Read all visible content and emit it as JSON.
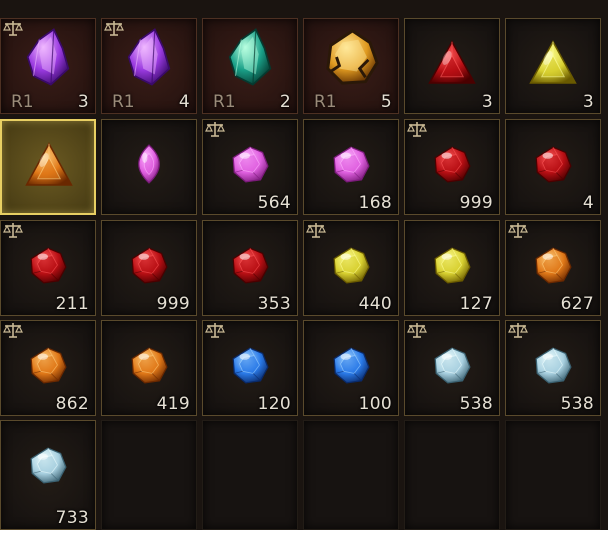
{
  "inventory": {
    "rows": [
      [
        {
          "kind": "rune",
          "icon": "purple-crystal-icon",
          "rank": "R1",
          "count": "3",
          "scale": true
        },
        {
          "kind": "rune",
          "icon": "purple-crystal-icon",
          "rank": "R1",
          "count": "4",
          "scale": true
        },
        {
          "kind": "rune",
          "icon": "green-crystal-icon",
          "rank": "R1",
          "count": "2",
          "scale": false
        },
        {
          "kind": "rune",
          "icon": "amber-crystal-icon",
          "rank": "R1",
          "count": "5",
          "scale": false
        },
        {
          "kind": "item",
          "icon": "red-triangle-gem-icon",
          "count": "3",
          "scale": false
        },
        {
          "kind": "item",
          "icon": "yellow-triangle-gem-icon",
          "count": "3",
          "scale": false
        }
      ],
      [
        {
          "kind": "selected",
          "icon": "orange-triangle-gem-icon",
          "count": "",
          "scale": false
        },
        {
          "kind": "item",
          "icon": "pink-marquise-gem-icon",
          "count": "",
          "scale": false
        },
        {
          "kind": "item",
          "icon": "pink-gem-icon",
          "count": "564",
          "scale": true
        },
        {
          "kind": "item",
          "icon": "pink-gem-icon",
          "count": "168",
          "scale": false
        },
        {
          "kind": "item",
          "icon": "red-gem-icon",
          "count": "999",
          "scale": true
        },
        {
          "kind": "item",
          "icon": "red-gem-icon",
          "count": "4",
          "scale": false
        }
      ],
      [
        {
          "kind": "item",
          "icon": "red-gem-icon",
          "count": "211",
          "scale": true
        },
        {
          "kind": "item",
          "icon": "red-gem-icon",
          "count": "999",
          "scale": false
        },
        {
          "kind": "item",
          "icon": "red-gem-icon",
          "count": "353",
          "scale": false
        },
        {
          "kind": "item",
          "icon": "yellow-gem-icon",
          "count": "440",
          "scale": true
        },
        {
          "kind": "item",
          "icon": "yellow-gem-icon",
          "count": "127",
          "scale": false
        },
        {
          "kind": "item",
          "icon": "orange-gem-icon",
          "count": "627",
          "scale": true
        }
      ],
      [
        {
          "kind": "item",
          "icon": "orange-gem-icon",
          "count": "862",
          "scale": true
        },
        {
          "kind": "item",
          "icon": "orange-gem-icon",
          "count": "419",
          "scale": false
        },
        {
          "kind": "item",
          "icon": "blue-gem-icon",
          "count": "120",
          "scale": true
        },
        {
          "kind": "item",
          "icon": "blue-gem-icon",
          "count": "100",
          "scale": false
        },
        {
          "kind": "item",
          "icon": "pale-blue-gem-icon",
          "count": "538",
          "scale": true
        },
        {
          "kind": "item",
          "icon": "pale-blue-gem-icon",
          "count": "538",
          "scale": true
        }
      ],
      [
        {
          "kind": "item",
          "icon": "pale-blue-gem-icon",
          "count": "733",
          "scale": false
        },
        {
          "kind": "empty"
        },
        {
          "kind": "empty"
        },
        {
          "kind": "empty"
        },
        {
          "kind": "empty"
        },
        {
          "kind": "empty"
        }
      ]
    ]
  },
  "colors": {
    "red": [
      "#ff5a5a",
      "#b80f14",
      "#4a0000"
    ],
    "pink": [
      "#ffb8ff",
      "#e060e0",
      "#7a1a7a"
    ],
    "yellow": [
      "#ffff9a",
      "#d8d030",
      "#6a5a00"
    ],
    "orange": [
      "#ffd080",
      "#e07818",
      "#6a2800"
    ],
    "blue": [
      "#a8d8ff",
      "#2a7ae8",
      "#0a2a6a"
    ],
    "paleblue": [
      "#f0ffff",
      "#a8d0e0",
      "#3a6070"
    ],
    "purple": [
      "#f0b8ff",
      "#9a3ae0",
      "#3a0a6a"
    ],
    "green": [
      "#b8ffe0",
      "#1aa088",
      "#053a30"
    ],
    "amber": [
      "#ffe89a",
      "#e09a20",
      "#5a2a00"
    ],
    "selected_border": "#e8cf63"
  }
}
